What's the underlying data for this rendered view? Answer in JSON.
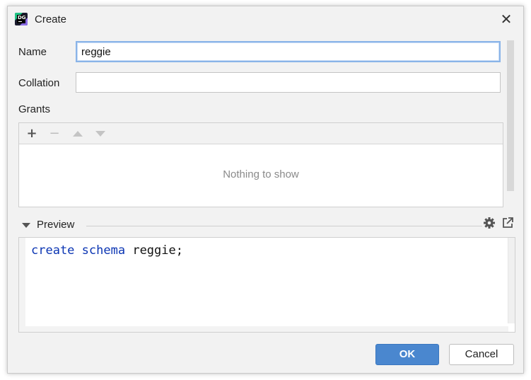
{
  "window": {
    "title": "Create",
    "close_glyph": "✕",
    "app_icon": "DG"
  },
  "form": {
    "name_label": "Name",
    "name_value": "reggie",
    "collation_label": "Collation",
    "collation_value": "",
    "grants_label": "Grants"
  },
  "grants": {
    "toolbar": {
      "add": "+",
      "remove": "−"
    },
    "empty_text": "Nothing to show"
  },
  "preview": {
    "label": "Preview",
    "code": {
      "kw1": "create",
      "kw2": "schema",
      "rest": " reggie;"
    }
  },
  "buttons": {
    "ok": "OK",
    "cancel": "Cancel"
  },
  "colors": {
    "accent": "#4a87cf",
    "keyword": "#0b35b3"
  }
}
